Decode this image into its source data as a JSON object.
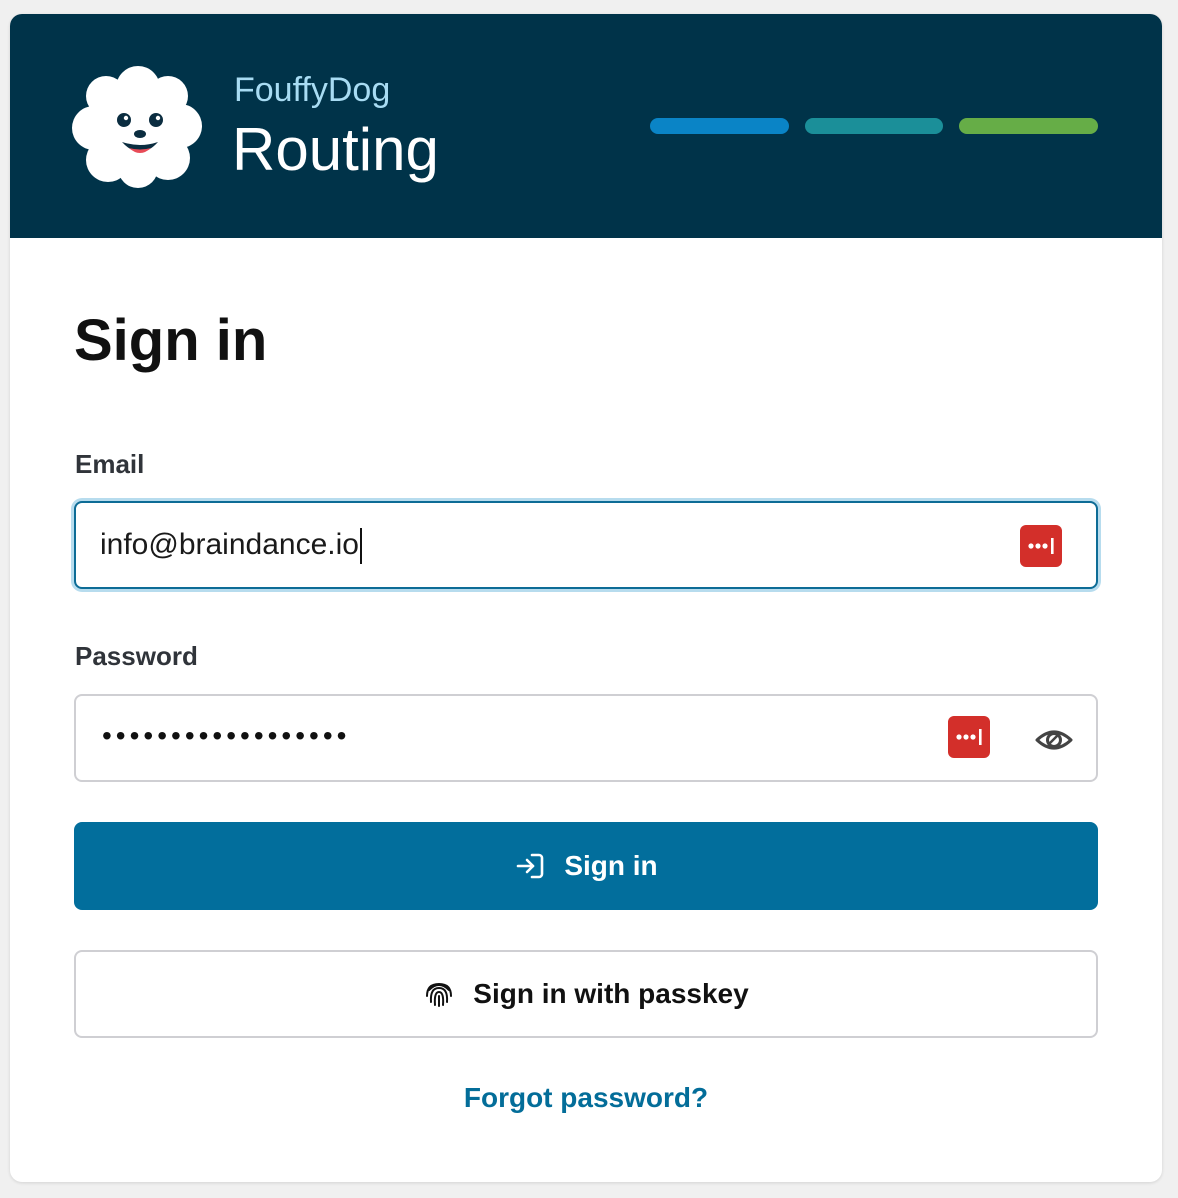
{
  "brand": {
    "subtitle": "FouffyDog",
    "title": "Routing",
    "logo_icon": "dog-logo-icon"
  },
  "progress_bars": [
    {
      "color": "#0a84c6"
    },
    {
      "color": "#1b8f99"
    },
    {
      "color": "#66ad47"
    }
  ],
  "form": {
    "title": "Sign in",
    "email": {
      "label": "Email",
      "value": "info@braindance.io",
      "icon": "password-manager-icon"
    },
    "password": {
      "label": "Password",
      "masked_value": "••••••••••••••••••",
      "icons": [
        "password-manager-icon",
        "eye-icon"
      ]
    },
    "sign_in_button": {
      "label": "Sign in",
      "icon": "sign-in-arrow-icon"
    },
    "passkey_button": {
      "label": "Sign in with passkey",
      "icon": "fingerprint-icon"
    },
    "forgot_link": "Forgot password?"
  },
  "colors": {
    "header_bg": "#003349",
    "primary": "#026e9c",
    "link": "#036d99",
    "password_manager": "#d32f2a"
  }
}
